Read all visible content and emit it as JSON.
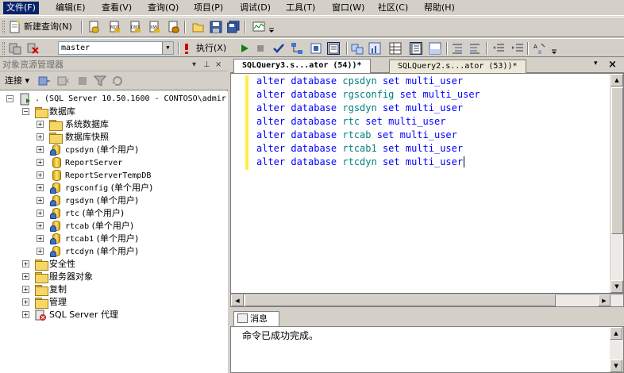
{
  "menu": [
    "文件(F)",
    "编辑(E)",
    "查看(V)",
    "查询(Q)",
    "项目(P)",
    "调试(D)",
    "工具(T)",
    "窗口(W)",
    "社区(C)",
    "帮助(H)"
  ],
  "toolbar1": {
    "new_query": "新建查询(N)"
  },
  "toolbar2": {
    "database": "master",
    "execute": "执行(X)"
  },
  "object_explorer": {
    "title": "对象资源管理器",
    "pin": "▾ ⊥ ×",
    "connect": "连接",
    "server": ". (SQL Server 10.50.1600 - CONTOSO\\admir",
    "databases": "数据库",
    "system_databases": "系统数据库",
    "snapshots": "数据库快照",
    "db_items": [
      {
        "name": "cpsdyn",
        "mode": " (单个用户)"
      },
      {
        "name": "ReportServer",
        "mode": ""
      },
      {
        "name": "ReportServerTempDB",
        "mode": ""
      },
      {
        "name": "rgsconfig",
        "mode": " (单个用户)"
      },
      {
        "name": "rgsdyn",
        "mode": " (单个用户)"
      },
      {
        "name": "rtc",
        "mode": " (单个用户)"
      },
      {
        "name": "rtcab",
        "mode": " (单个用户)"
      },
      {
        "name": "rtcab1",
        "mode": " (单个用户)"
      },
      {
        "name": "rtcdyn",
        "mode": " (单个用户)"
      }
    ],
    "security": "安全性",
    "server_objects": "服务器对象",
    "replication": "复制",
    "management": "管理",
    "agent": "SQL Server 代理"
  },
  "editor": {
    "tabs": [
      {
        "label": "SQLQuery3.s...ator (54))*"
      },
      {
        "label": "SQLQuery2.s...ator (53))*"
      }
    ],
    "lines": [
      {
        "a": "alter database ",
        "db": "cpsdyn",
        "b": " set multi_user"
      },
      {
        "a": "alter database ",
        "db": "rgsconfig",
        "b": " set multi_user"
      },
      {
        "a": "alter database ",
        "db": "rgsdyn",
        "b": " set multi_user"
      },
      {
        "a": "alter database ",
        "db": "rtc",
        "b": " set multi_user"
      },
      {
        "a": "alter database ",
        "db": "rtcab",
        "b": " set multi_user"
      },
      {
        "a": "alter database ",
        "db": "rtcab1",
        "b": " set multi_user"
      },
      {
        "a": "alter database ",
        "db": "rtcdyn",
        "b": " set multi_user"
      }
    ]
  },
  "results": {
    "tab": "消息",
    "message": "命令已成功完成。"
  },
  "colors": {
    "keyword": "#0000ff",
    "identifier": "#008080",
    "menu_highlight": "#0a246a"
  }
}
